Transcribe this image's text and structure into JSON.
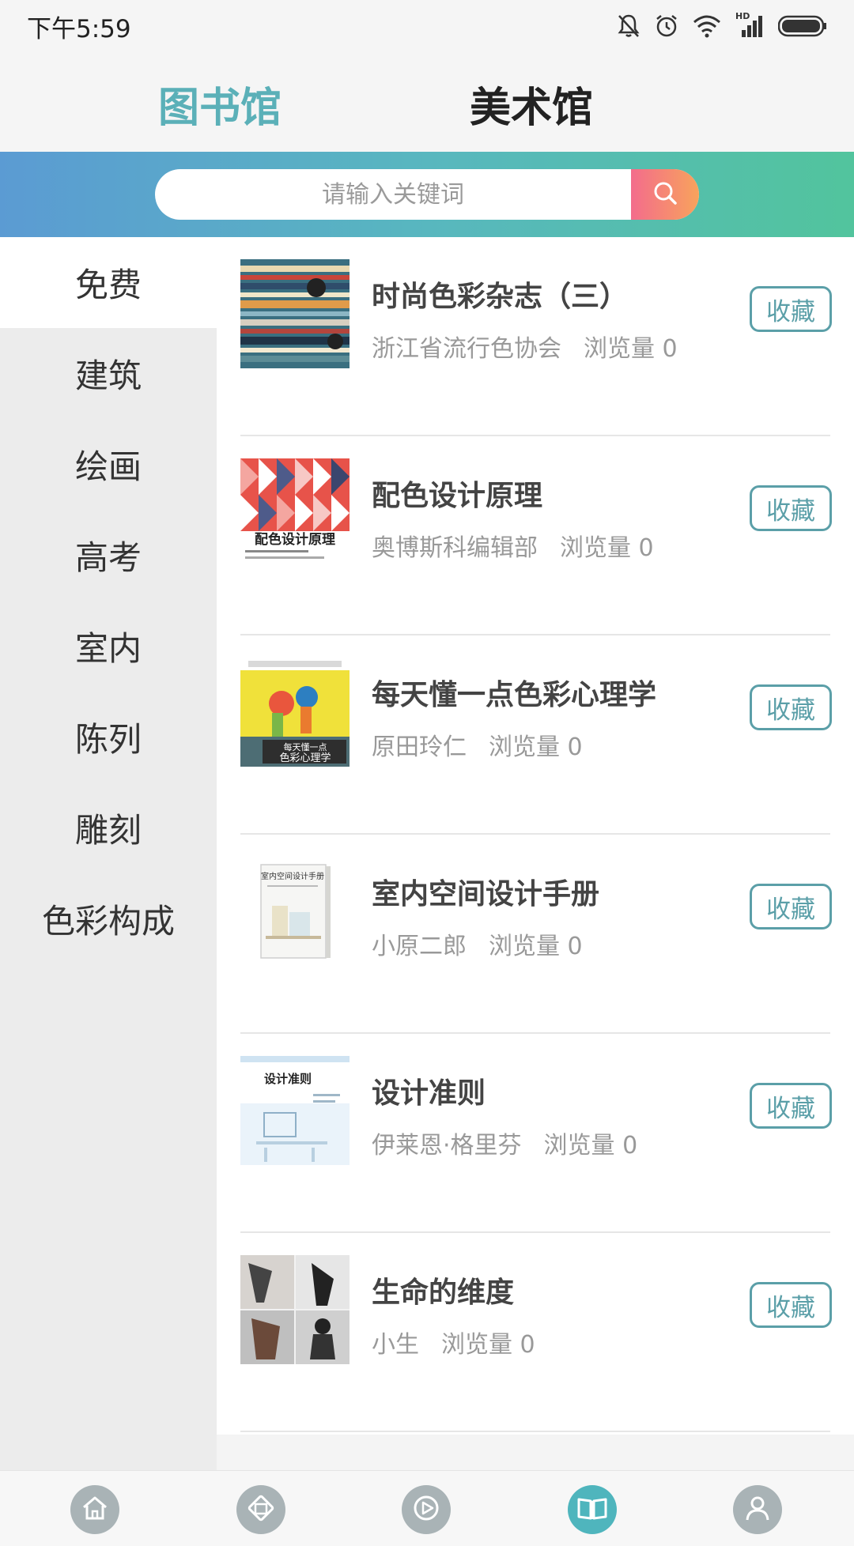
{
  "status_bar": {
    "time": "下午5:59",
    "icons": [
      "mute-icon",
      "alarm-icon",
      "wifi-icon",
      "hd-signal-icon",
      "battery-icon"
    ],
    "signal_label": "HD"
  },
  "top_tabs": {
    "library": "图书馆",
    "museum": "美术馆",
    "active": "library"
  },
  "search": {
    "placeholder": "请输入关键词"
  },
  "sidebar": {
    "items": [
      {
        "label": "免费",
        "active": true
      },
      {
        "label": "建筑",
        "active": false
      },
      {
        "label": "绘画",
        "active": false
      },
      {
        "label": "高考",
        "active": false
      },
      {
        "label": "室内",
        "active": false
      },
      {
        "label": "陈列",
        "active": false
      },
      {
        "label": "雕刻",
        "active": false
      },
      {
        "label": "色彩构成",
        "active": false
      }
    ]
  },
  "books": [
    {
      "title": "时尚色彩杂志（三）",
      "author": "浙江省流行色协会",
      "views": "浏览量 0",
      "fav_label": "收藏"
    },
    {
      "title": "配色设计原理",
      "author": "奥博斯科编辑部",
      "views": "浏览量 0",
      "fav_label": "收藏",
      "cover_text": "配色设计原理"
    },
    {
      "title": "每天懂一点色彩心理学",
      "author": "原田玲仁",
      "views": "浏览量 0",
      "fav_label": "收藏",
      "cover_text": "每天懂一点 色彩心理学"
    },
    {
      "title": "室内空间设计手册",
      "author": "小原二郎",
      "views": "浏览量 0",
      "fav_label": "收藏",
      "cover_text": "室内空间设计手册"
    },
    {
      "title": "设计准则",
      "author": "伊莱恩·格里芬",
      "views": "浏览量 0",
      "fav_label": "收藏",
      "cover_text": "设计准则"
    },
    {
      "title": "生命的维度",
      "author": "小生",
      "views": "浏览量 0",
      "fav_label": "收藏"
    }
  ],
  "bottom_nav": {
    "items": [
      {
        "icon": "home-icon",
        "active": false
      },
      {
        "icon": "gallery-icon",
        "active": false
      },
      {
        "icon": "play-icon",
        "active": false
      },
      {
        "icon": "book-icon",
        "active": true
      },
      {
        "icon": "profile-icon",
        "active": false
      }
    ]
  },
  "colors": {
    "accent": "#5bb0b8",
    "fav_border": "#5b9fa8",
    "search_gradient_start": "#5b9bd3",
    "search_gradient_end": "#52c49d",
    "search_button_start": "#f36c8c",
    "search_button_end": "#f8a35c"
  }
}
